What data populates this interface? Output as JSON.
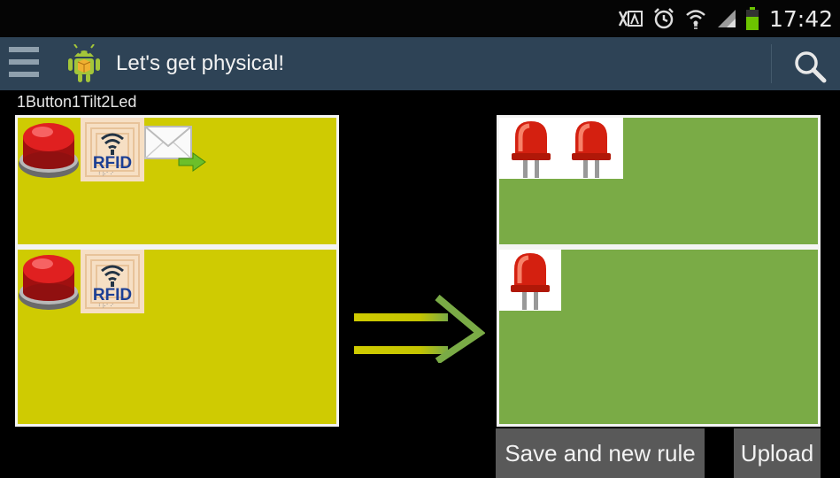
{
  "status_bar": {
    "time": "17:42",
    "icons": [
      "nfc-icon",
      "alarm-icon",
      "wifi-icon",
      "signal-icon",
      "battery-icon"
    ]
  },
  "action_bar": {
    "title": "Let's get physical!",
    "icons": [
      "menu-icon",
      "android-app-icon",
      "search-icon"
    ]
  },
  "rule": {
    "name": "1Button1Tilt2Led",
    "conditions": [
      {
        "icons": [
          "red-push-button-icon",
          "rfid-tag-icon",
          "envelope-send-icon"
        ]
      },
      {
        "icons": [
          "red-push-button-icon",
          "rfid-tag-icon"
        ]
      }
    ],
    "actions": [
      {
        "icons": [
          "red-led-icon",
          "red-led-icon"
        ]
      },
      {
        "icons": [
          "red-led-icon"
        ]
      }
    ]
  },
  "buttons": {
    "save_new": "Save and new rule",
    "upload": "Upload"
  },
  "colors": {
    "condition_bg": "#cfcb02",
    "action_bg": "#7aab46",
    "action_bar_bg": "#2e4356",
    "arrow": "#c6c100"
  }
}
